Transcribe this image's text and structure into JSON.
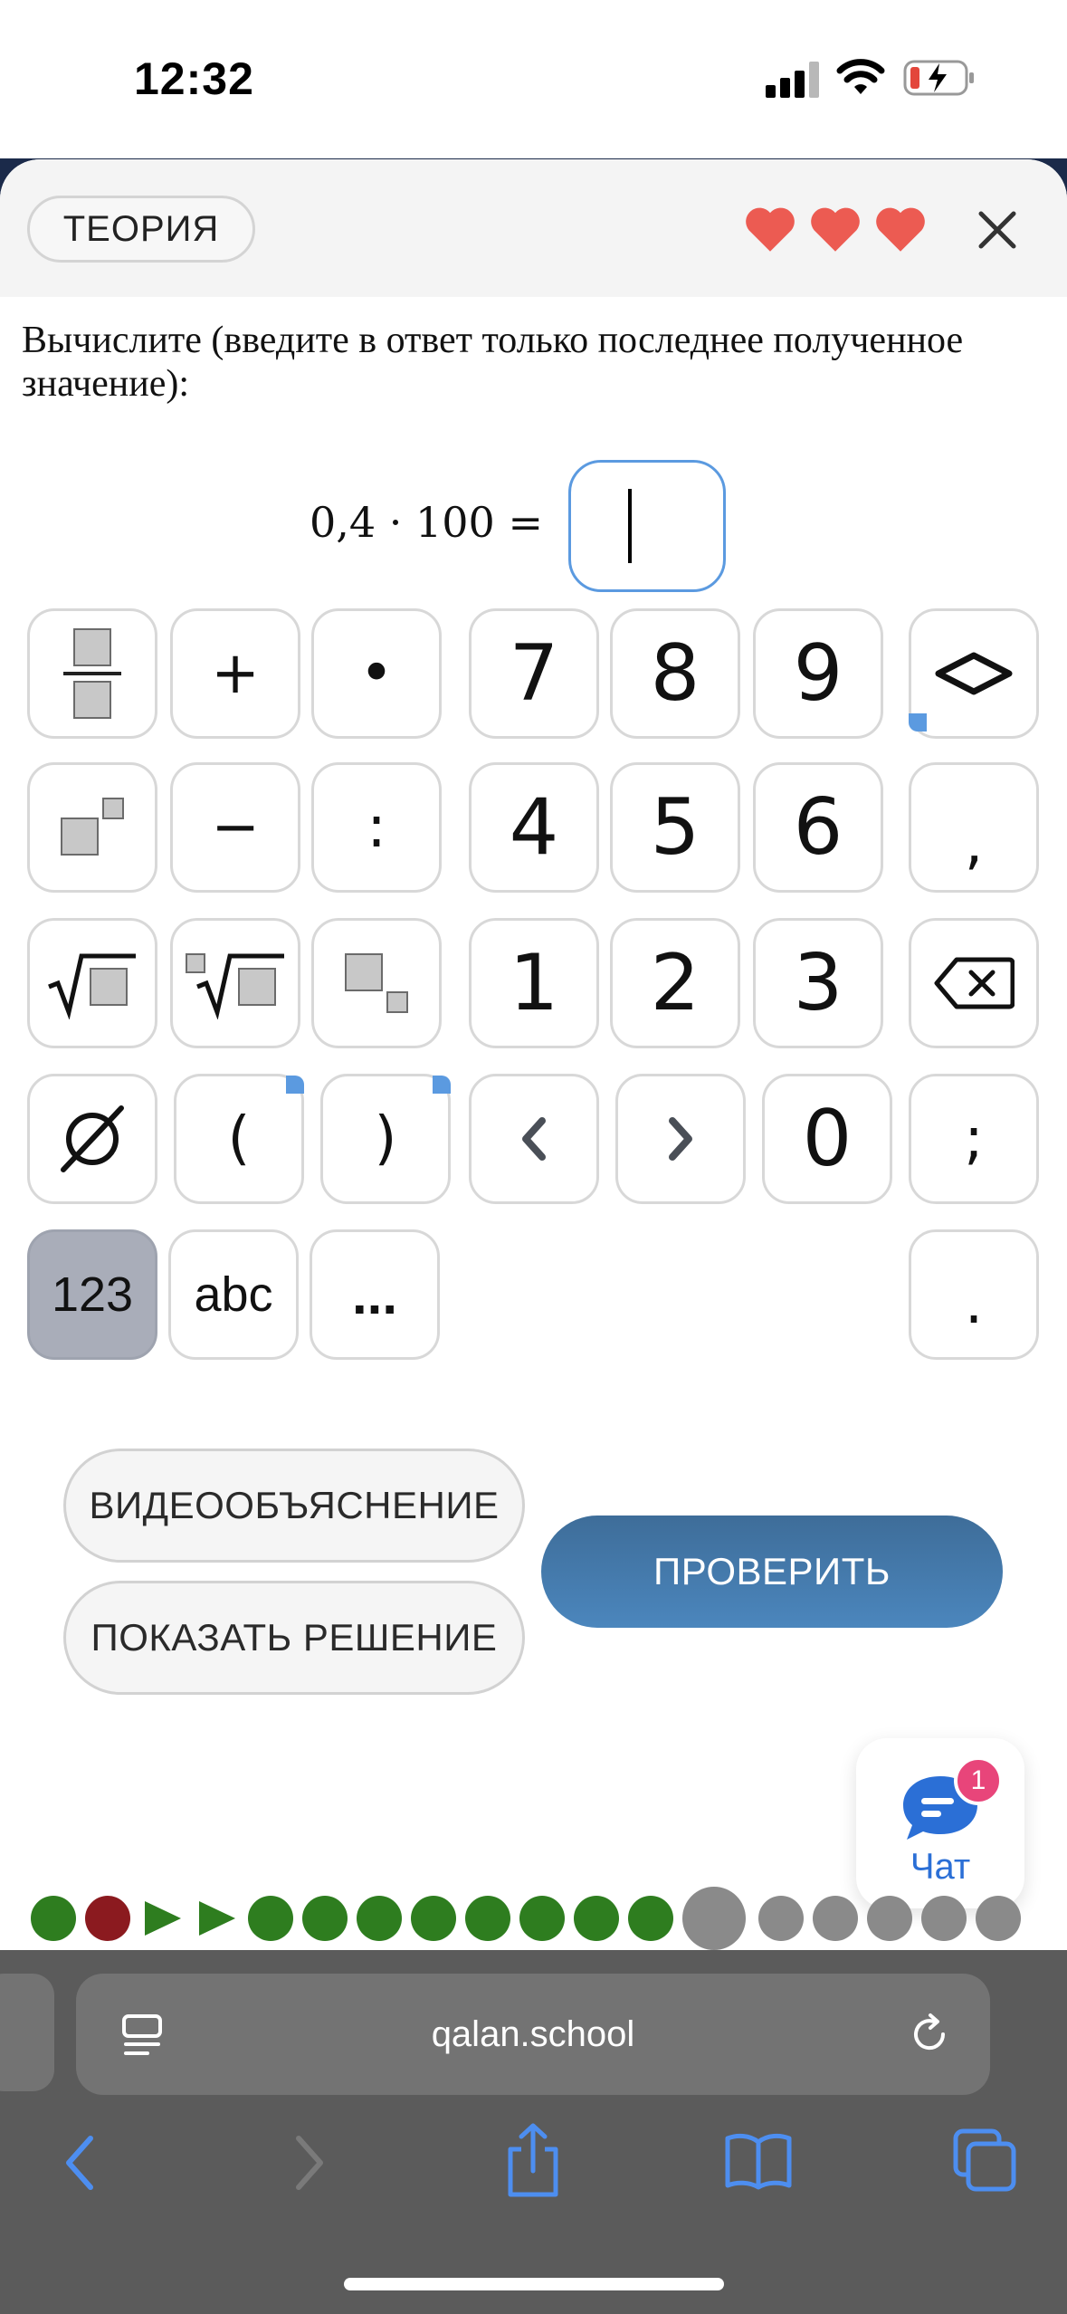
{
  "status_bar": {
    "time": "12:32"
  },
  "header": {
    "theory_label": "ТЕОРИЯ",
    "lives": 3,
    "colors": {
      "heart": "#ec5b52"
    }
  },
  "question": {
    "prompt": "Вычислите (введите в ответ только последнее полученное значение):",
    "expression": "0,4 · 100 =",
    "answer_value": ""
  },
  "keypad": {
    "row1": {
      "plus": "+",
      "dot": "•",
      "d7": "7",
      "d8": "8",
      "d9": "9"
    },
    "row2": {
      "minus": "−",
      "colon": ":",
      "d4": "4",
      "d5": "5",
      "d6": "6",
      "comma": ","
    },
    "row3": {
      "d1": "1",
      "d2": "2",
      "d3": "3"
    },
    "row4": {
      "lparen": "(",
      "rparen": ")",
      "d0": "0",
      "semicolon": ";"
    },
    "row5": {
      "mode_123": "123",
      "mode_abc": "abc",
      "more": "...",
      "period": "."
    },
    "icons": [
      "fraction-icon",
      "power-icon",
      "sqrt-icon",
      "nth-root-icon",
      "subscript-icon",
      "empty-set-icon",
      "cursor-left-icon",
      "cursor-right-icon",
      "backspace-icon",
      "collapse-icon"
    ]
  },
  "actions": {
    "video_label": "ВИДЕООБЪЯСНЕНИЕ",
    "solution_label": "ПОКАЗАТЬ РЕШЕНИЕ",
    "check_label": "ПРОВЕРИТЬ"
  },
  "chat": {
    "label": "Чат",
    "badge": "1"
  },
  "progress": {
    "colors": {
      "done": "#2e7d1f",
      "wrong": "#8b1a1f",
      "current": "#8a8a8a",
      "pending": "#8a8a8a"
    },
    "items": [
      "done",
      "wrong",
      "skip",
      "skip",
      "done",
      "done",
      "done",
      "done",
      "done",
      "done",
      "done",
      "done",
      "current",
      "pending",
      "pending",
      "pending",
      "pending",
      "pending"
    ]
  },
  "browser": {
    "url": "qalan.school"
  }
}
